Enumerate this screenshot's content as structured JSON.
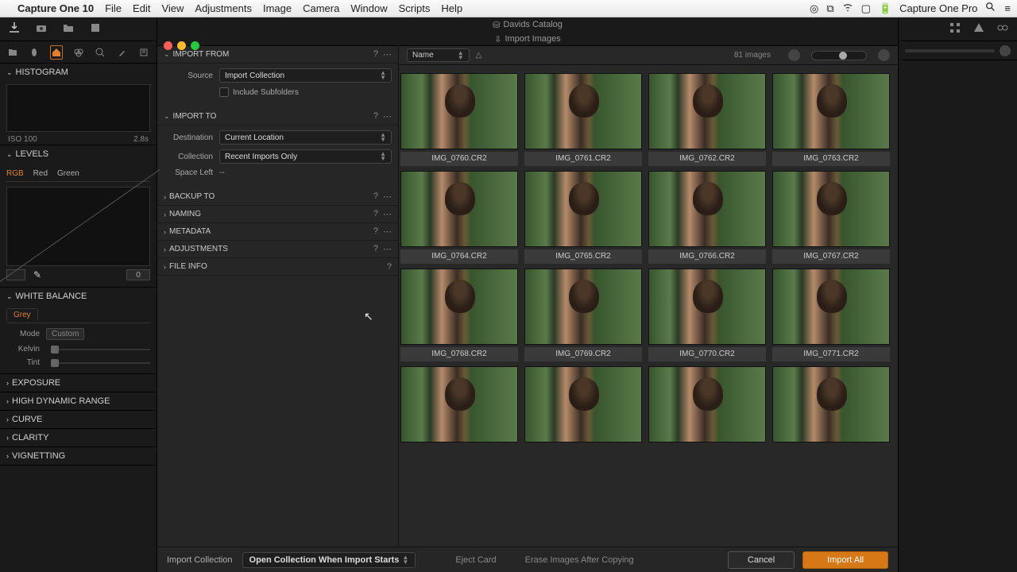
{
  "menubar": {
    "app": "Capture One 10",
    "items": [
      "File",
      "Edit",
      "View",
      "Adjustments",
      "Image",
      "Camera",
      "Window",
      "Scripts",
      "Help"
    ],
    "right_app": "Capture One Pro"
  },
  "window": {
    "catalog": "Davids Catalog",
    "dialog": "Import Images"
  },
  "left": {
    "histogram": {
      "title": "HISTOGRAM",
      "iso": "ISO 100",
      "shutter": "2.8s"
    },
    "levels": {
      "title": "LEVELS",
      "tabs": [
        "RGB",
        "Red",
        "Green"
      ],
      "num": "0"
    },
    "wb": {
      "title": "WHITE BALANCE",
      "tab": "Grey",
      "mode_lbl": "Mode",
      "mode_val": "Custom",
      "kelvin_lbl": "Kelvin",
      "tint_lbl": "Tint"
    },
    "collapsed": [
      "EXPOSURE",
      "HIGH DYNAMIC RANGE",
      "CURVE",
      "CLARITY",
      "VIGNETTING"
    ]
  },
  "importFrom": {
    "title": "IMPORT FROM",
    "source_lbl": "Source",
    "source_val": "Import Collection",
    "subfolders_lbl": "Include Subfolders"
  },
  "importTo": {
    "title": "IMPORT TO",
    "dest_lbl": "Destination",
    "dest_val": "Current Location",
    "coll_lbl": "Collection",
    "coll_val": "Recent Imports Only",
    "space_lbl": "Space Left",
    "space_val": "--"
  },
  "collapsedSecs": [
    "BACKUP TO",
    "NAMING",
    "METADATA",
    "ADJUSTMENTS",
    "FILE INFO"
  ],
  "gridBar": {
    "sort": "Name",
    "count": "81 images"
  },
  "thumbs": [
    "IMG_0760.CR2",
    "IMG_0761.CR2",
    "IMG_0762.CR2",
    "IMG_0763.CR2",
    "IMG_0764.CR2",
    "IMG_0765.CR2",
    "IMG_0766.CR2",
    "IMG_0767.CR2",
    "IMG_0768.CR2",
    "IMG_0769.CR2",
    "IMG_0770.CR2",
    "IMG_0771.CR2",
    "",
    "",
    "",
    ""
  ],
  "bottom": {
    "coll_lbl": "Import Collection",
    "coll_val": "Open Collection When Import Starts",
    "eject": "Eject Card",
    "erase": "Erase Images After Copying",
    "cancel": "Cancel",
    "import": "Import All"
  }
}
